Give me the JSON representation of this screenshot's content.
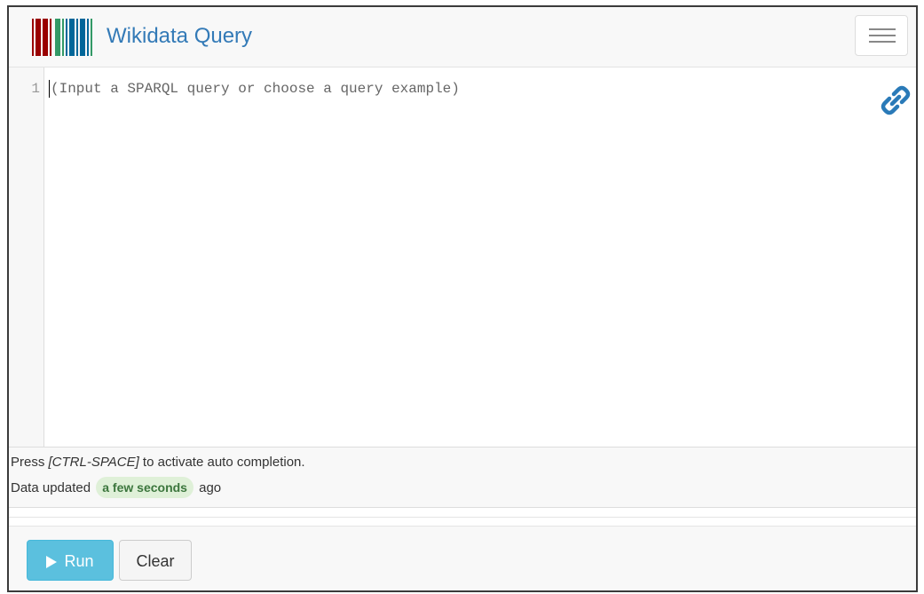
{
  "navbar": {
    "brand": "Wikidata Query",
    "menu_icon": "hamburger-menu-icon",
    "logo_icon": "wikidata-barcode-logo"
  },
  "editor": {
    "line_number": "1",
    "placeholder": "(Input a SPARQL query or choose a query example)",
    "link_icon": "link-icon"
  },
  "status": {
    "hint_prefix": "Press ",
    "hint_key": "[CTRL-SPACE]",
    "hint_suffix": " to activate auto completion.",
    "updated_prefix": "Data updated",
    "updated_time": "a few seconds",
    "updated_suffix": "ago"
  },
  "actions": {
    "run_label": "Run",
    "clear_label": "Clear"
  },
  "colors": {
    "brand": "#337ab7",
    "run_button": "#5bc0de",
    "badge_bg": "#dff0d8",
    "badge_text": "#3c763d",
    "logo_red": "#990000",
    "logo_green": "#339966",
    "logo_blue": "#006699"
  }
}
